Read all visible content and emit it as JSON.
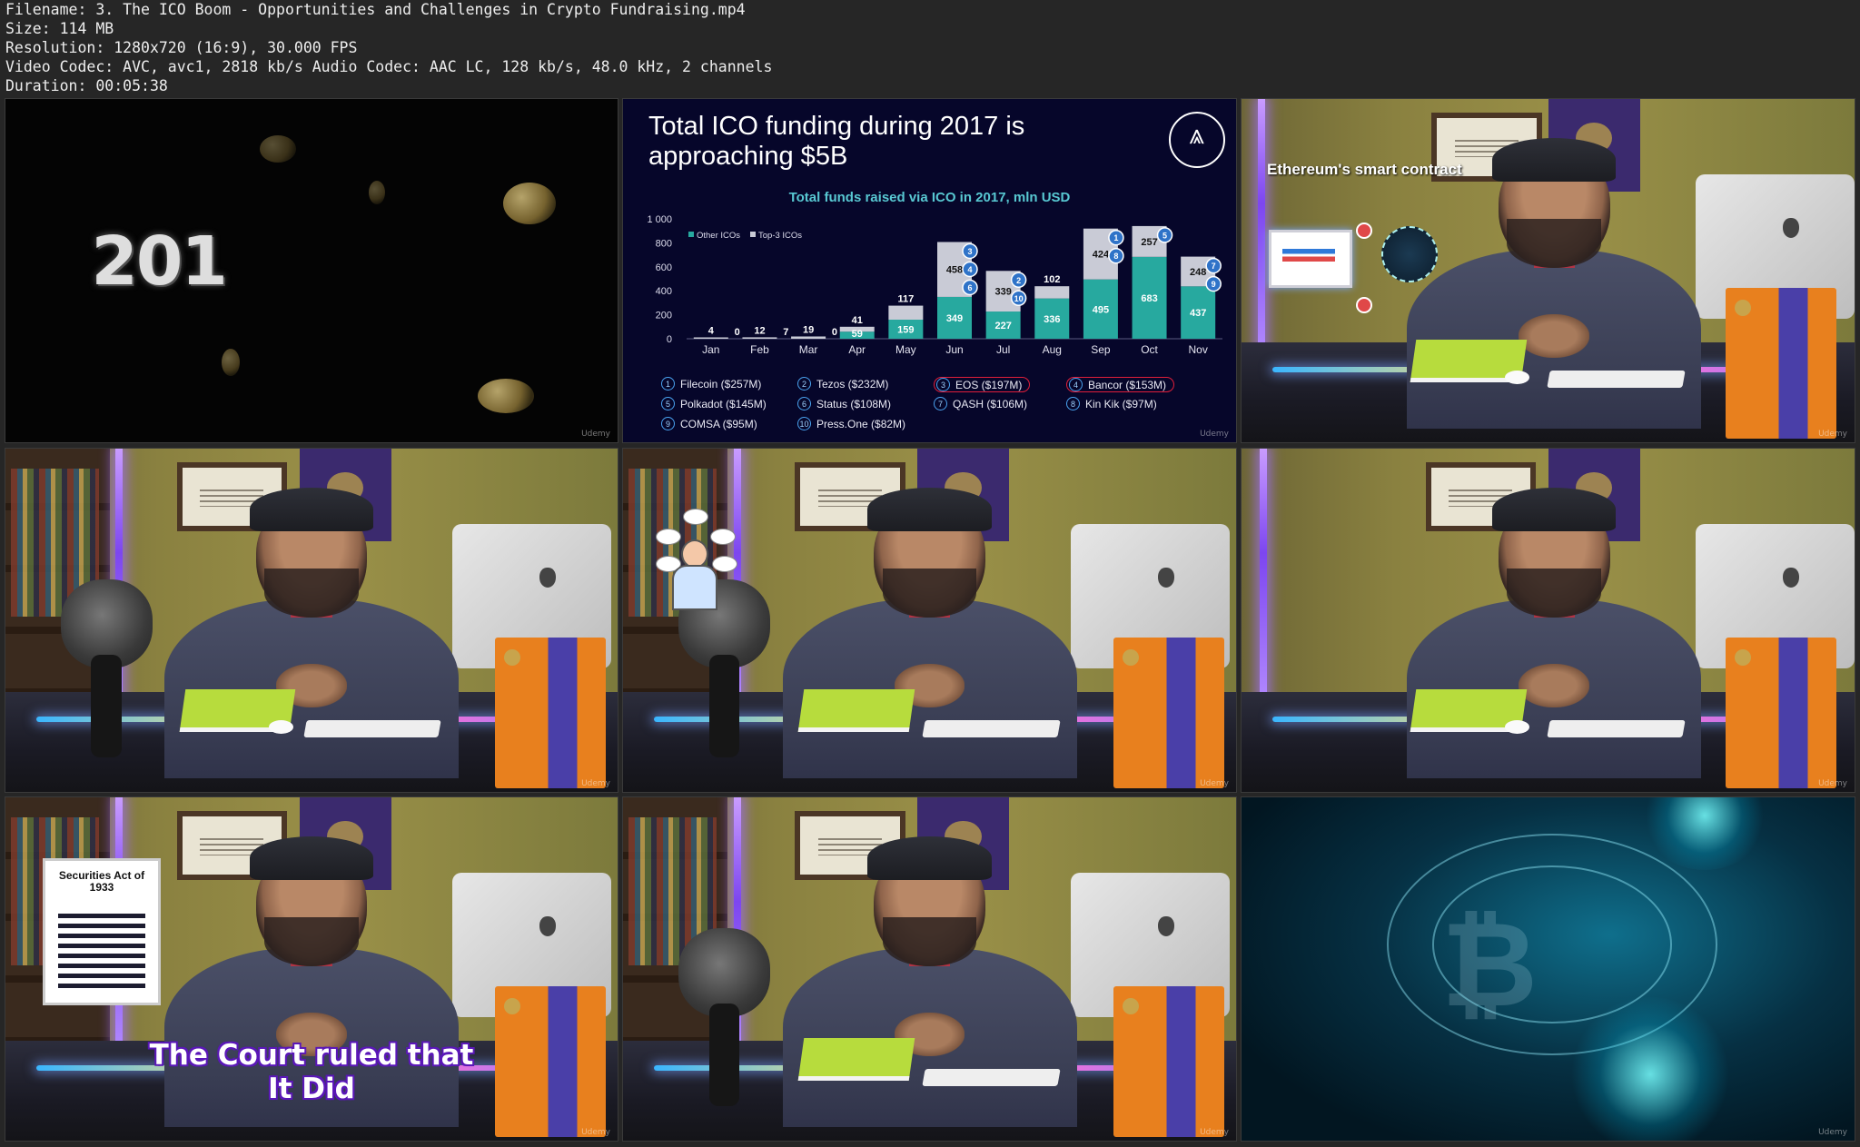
{
  "header": {
    "filename": "Filename: 3. The ICO Boom - Opportunities and Challenges in Crypto Fundraising.mp4",
    "size": "Size: 114 MB",
    "resolution": "Resolution: 1280x720 (16:9), 30.000 FPS",
    "codec": "Video Codec: AVC, avc1, 2818 kb/s Audio Codec: AAC LC, 128 kb/s, 48.0 kHz, 2 channels",
    "duration": "Duration: 00:05:38"
  },
  "frames": {
    "intro": {
      "year_text": "201"
    },
    "chart": {
      "title": "Total ICO funding during 2017 is approaching $5B",
      "subtitle": "Total funds raised via ICO in 2017, mln USD",
      "legend_other": "Other ICOs",
      "legend_top3": "Top-3 ICOs"
    },
    "smart_contract": {
      "label": "Ethereum's smart contract"
    },
    "securities": {
      "doc_title": "Securities Act of 1933",
      "caption_line1": "The Court ruled that",
      "caption_line2": "It Did"
    }
  },
  "chart_data": {
    "type": "bar",
    "stacked": true,
    "title": "Total funds raised via ICO in 2017, mln USD",
    "categories": [
      "Jan",
      "Feb",
      "Mar",
      "Apr",
      "May",
      "Jun",
      "Jul",
      "Aug",
      "Sep",
      "Oct",
      "Nov"
    ],
    "series": [
      {
        "name": "Top-3 ICOs",
        "values": [
          0,
          0,
          0,
          59,
          159,
          349,
          227,
          336,
          495,
          683,
          437
        ],
        "labels": [
          "",
          "",
          "",
          "59",
          "159",
          "349",
          "227",
          "336",
          "495",
          "683",
          "437"
        ]
      },
      {
        "name": "Other ICOs",
        "values": [
          4,
          12,
          19,
          41,
          117,
          458,
          339,
          102,
          424,
          257,
          248
        ],
        "labels": [
          "4",
          "12",
          "19",
          "41",
          "117",
          "458",
          "339",
          "102",
          "424",
          "257",
          "248"
        ]
      }
    ],
    "extra_labels": [
      {
        "category": "Feb",
        "text": "0",
        "position": "left"
      },
      {
        "category": "Mar",
        "text": "7",
        "position": "left"
      },
      {
        "category": "Apr",
        "text": "0",
        "position": "left"
      }
    ],
    "yticks": [
      "0",
      "200",
      "400",
      "600",
      "800",
      "1 000"
    ],
    "ylim": [
      0,
      1000
    ],
    "markers": [
      {
        "category": "Jun",
        "nums": [
          "3",
          "4",
          "6"
        ]
      },
      {
        "category": "Jul",
        "nums": [
          "2",
          "10"
        ]
      },
      {
        "category": "Sep",
        "nums": [
          "1",
          "8"
        ]
      },
      {
        "category": "Oct",
        "nums": [
          "5"
        ]
      },
      {
        "category": "Nov",
        "nums": [
          "7",
          "9"
        ]
      }
    ],
    "top_icos": [
      {
        "num": "1",
        "label": "Filecoin ($257M)",
        "highlight": false
      },
      {
        "num": "2",
        "label": "Tezos ($232M)",
        "highlight": false
      },
      {
        "num": "3",
        "label": "EOS ($197M)",
        "highlight": true
      },
      {
        "num": "4",
        "label": "Bancor ($153M)",
        "highlight": true
      },
      {
        "num": "5",
        "label": "Polkadot ($145M)",
        "highlight": false
      },
      {
        "num": "6",
        "label": "Status ($108M)",
        "highlight": false
      },
      {
        "num": "7",
        "label": "QASH ($106M)",
        "highlight": false
      },
      {
        "num": "8",
        "label": "Kin Kik ($97M)",
        "highlight": false
      },
      {
        "num": "9",
        "label": "COMSA ($95M)",
        "highlight": false
      },
      {
        "num": "10",
        "label": "Press.One ($82M)",
        "highlight": false
      }
    ],
    "colors": {
      "top3": "#27a99f",
      "other": "#c9cbd6",
      "marker": "#2f73c8",
      "background": "#06062a"
    }
  },
  "watermark": "Udemy"
}
